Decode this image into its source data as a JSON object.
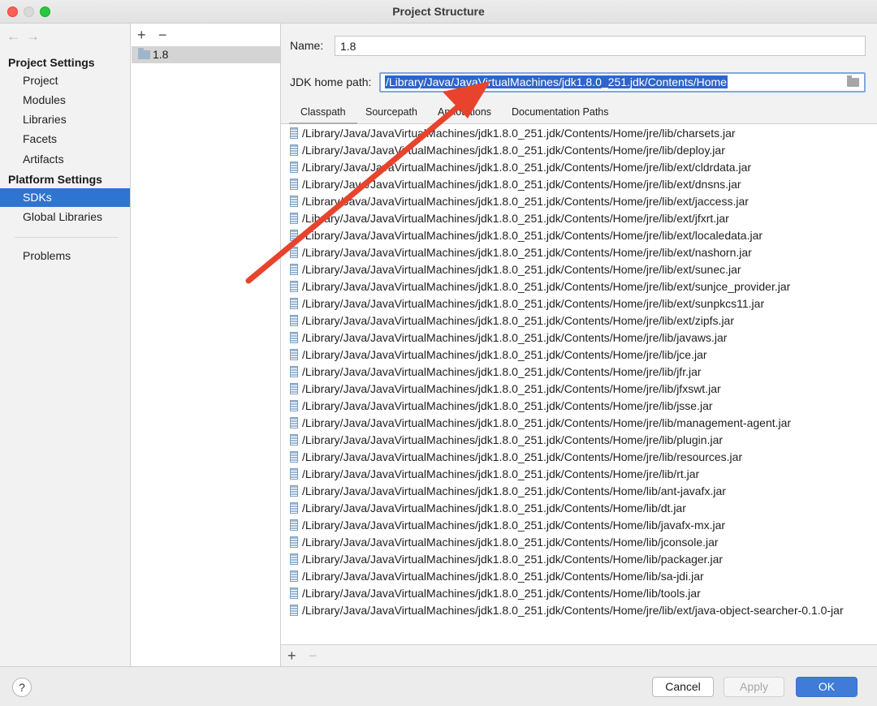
{
  "window": {
    "title": "Project Structure"
  },
  "navigation": {
    "back_icon": "←",
    "forward_icon": "→"
  },
  "sidebar": {
    "project_settings_heading": "Project Settings",
    "project_items": [
      "Project",
      "Modules",
      "Libraries",
      "Facets",
      "Artifacts"
    ],
    "platform_settings_heading": "Platform Settings",
    "platform_items": [
      "SDKs",
      "Global Libraries"
    ],
    "selected": "SDKs",
    "problems": "Problems"
  },
  "sdk_list": {
    "add_icon": "+",
    "remove_icon": "−",
    "items": [
      "1.8"
    ]
  },
  "details": {
    "name_label": "Name:",
    "name_value": "1.8",
    "jdk_home_label": "JDK home path:",
    "jdk_home_value": "/Library/Java/JavaVirtualMachines/jdk1.8.0_251.jdk/Contents/Home",
    "tabs": [
      "Classpath",
      "Sourcepath",
      "Annotations",
      "Documentation Paths"
    ],
    "active_tab": "Classpath"
  },
  "classpath": [
    "/Library/Java/JavaVirtualMachines/jdk1.8.0_251.jdk/Contents/Home/jre/lib/charsets.jar",
    "/Library/Java/JavaVirtualMachines/jdk1.8.0_251.jdk/Contents/Home/jre/lib/deploy.jar",
    "/Library/Java/JavaVirtualMachines/jdk1.8.0_251.jdk/Contents/Home/jre/lib/ext/cldrdata.jar",
    "/Library/Java/JavaVirtualMachines/jdk1.8.0_251.jdk/Contents/Home/jre/lib/ext/dnsns.jar",
    "/Library/Java/JavaVirtualMachines/jdk1.8.0_251.jdk/Contents/Home/jre/lib/ext/jaccess.jar",
    "/Library/Java/JavaVirtualMachines/jdk1.8.0_251.jdk/Contents/Home/jre/lib/ext/jfxrt.jar",
    "/Library/Java/JavaVirtualMachines/jdk1.8.0_251.jdk/Contents/Home/jre/lib/ext/localedata.jar",
    "/Library/Java/JavaVirtualMachines/jdk1.8.0_251.jdk/Contents/Home/jre/lib/ext/nashorn.jar",
    "/Library/Java/JavaVirtualMachines/jdk1.8.0_251.jdk/Contents/Home/jre/lib/ext/sunec.jar",
    "/Library/Java/JavaVirtualMachines/jdk1.8.0_251.jdk/Contents/Home/jre/lib/ext/sunjce_provider.jar",
    "/Library/Java/JavaVirtualMachines/jdk1.8.0_251.jdk/Contents/Home/jre/lib/ext/sunpkcs11.jar",
    "/Library/Java/JavaVirtualMachines/jdk1.8.0_251.jdk/Contents/Home/jre/lib/ext/zipfs.jar",
    "/Library/Java/JavaVirtualMachines/jdk1.8.0_251.jdk/Contents/Home/jre/lib/javaws.jar",
    "/Library/Java/JavaVirtualMachines/jdk1.8.0_251.jdk/Contents/Home/jre/lib/jce.jar",
    "/Library/Java/JavaVirtualMachines/jdk1.8.0_251.jdk/Contents/Home/jre/lib/jfr.jar",
    "/Library/Java/JavaVirtualMachines/jdk1.8.0_251.jdk/Contents/Home/jre/lib/jfxswt.jar",
    "/Library/Java/JavaVirtualMachines/jdk1.8.0_251.jdk/Contents/Home/jre/lib/jsse.jar",
    "/Library/Java/JavaVirtualMachines/jdk1.8.0_251.jdk/Contents/Home/jre/lib/management-agent.jar",
    "/Library/Java/JavaVirtualMachines/jdk1.8.0_251.jdk/Contents/Home/jre/lib/plugin.jar",
    "/Library/Java/JavaVirtualMachines/jdk1.8.0_251.jdk/Contents/Home/jre/lib/resources.jar",
    "/Library/Java/JavaVirtualMachines/jdk1.8.0_251.jdk/Contents/Home/jre/lib/rt.jar",
    "/Library/Java/JavaVirtualMachines/jdk1.8.0_251.jdk/Contents/Home/lib/ant-javafx.jar",
    "/Library/Java/JavaVirtualMachines/jdk1.8.0_251.jdk/Contents/Home/lib/dt.jar",
    "/Library/Java/JavaVirtualMachines/jdk1.8.0_251.jdk/Contents/Home/lib/javafx-mx.jar",
    "/Library/Java/JavaVirtualMachines/jdk1.8.0_251.jdk/Contents/Home/lib/jconsole.jar",
    "/Library/Java/JavaVirtualMachines/jdk1.8.0_251.jdk/Contents/Home/lib/packager.jar",
    "/Library/Java/JavaVirtualMachines/jdk1.8.0_251.jdk/Contents/Home/lib/sa-jdi.jar",
    "/Library/Java/JavaVirtualMachines/jdk1.8.0_251.jdk/Contents/Home/lib/tools.jar",
    "/Library/Java/JavaVirtualMachines/jdk1.8.0_251.jdk/Contents/Home/jre/lib/ext/java-object-searcher-0.1.0-jar"
  ],
  "classpath_tools": {
    "add_icon": "+",
    "remove_icon": "−"
  },
  "footer": {
    "help_icon": "?",
    "cancel": "Cancel",
    "apply": "Apply",
    "ok": "OK"
  },
  "colors": {
    "selection": "#2f74d0",
    "ok_button": "#3f7bd7",
    "annotation_arrow": "#e8432d",
    "traffic_close": "#ff5f57",
    "traffic_max": "#28c840"
  },
  "icons": {
    "sdk_item": "folder-icon",
    "classpath_entry": "jar-file-icon",
    "browse": "folder-open-icon",
    "annotation": "red-arrow-icon"
  }
}
